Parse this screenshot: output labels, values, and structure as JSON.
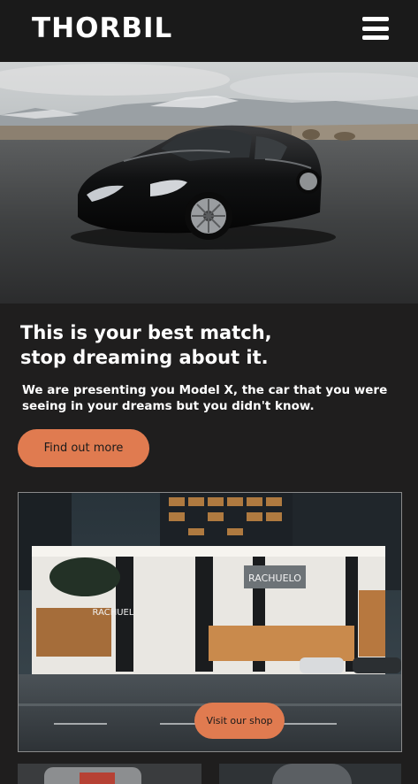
{
  "header": {
    "logo": "THORBIL",
    "menu_icon": "hamburger-menu-icon"
  },
  "hero": {
    "image": "black sports car parked on asphalt with mountains"
  },
  "intro": {
    "headline_line1": "This is your best match,",
    "headline_line2": "stop dreaming about it.",
    "description": "We are presenting you Model X, the car that you were seeing in your dreams but you didn't know.",
    "cta_label": "Find out more"
  },
  "shop": {
    "image": "modern dealership building at dusk",
    "store_sign_top": "RACHUELO",
    "store_sign_side": "RACHUEL",
    "cta_label": "Visit our shop"
  },
  "colors": {
    "background": "#1f1e1e",
    "header": "#1a1a1a",
    "accent": "#e07b50",
    "text": "#ffffff"
  }
}
